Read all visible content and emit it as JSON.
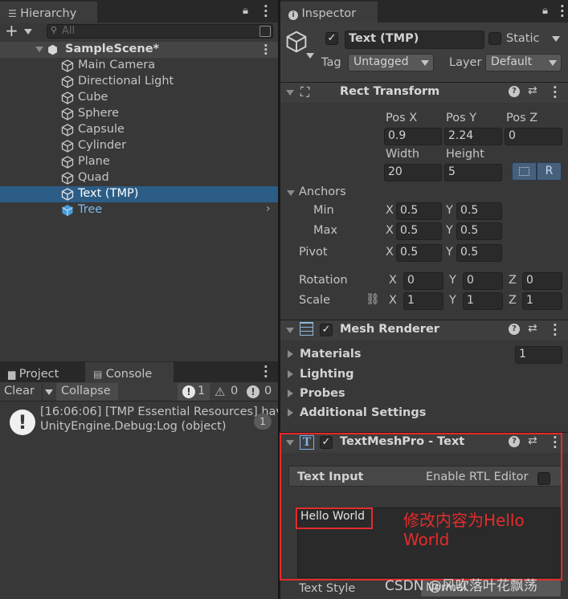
{
  "hierarchy": {
    "tab_label": "Hierarchy",
    "search_placeholder": "All",
    "add_label": "+",
    "scene_name": "SampleScene*",
    "items": [
      {
        "label": "Main Camera"
      },
      {
        "label": "Directional Light"
      },
      {
        "label": "Cube"
      },
      {
        "label": "Sphere"
      },
      {
        "label": "Capsule"
      },
      {
        "label": "Cylinder"
      },
      {
        "label": "Plane"
      },
      {
        "label": "Quad"
      },
      {
        "label": "Text (TMP)"
      },
      {
        "label": "Tree"
      }
    ]
  },
  "bottom_panel": {
    "tabs": [
      {
        "label": "Project"
      },
      {
        "label": "Console"
      }
    ],
    "clear_label": "Clear",
    "collapse_label": "Collapse",
    "counts": {
      "errors": "1",
      "warnings": "0",
      "infos": "0"
    },
    "log": {
      "line1": "[16:06:06] [TMP Essential Resources] hav",
      "line2": "UnityEngine.Debug:Log (object)",
      "count": "1"
    }
  },
  "inspector": {
    "tab_label": "Inspector",
    "object_name": "Text (TMP)",
    "static_label": "Static",
    "tag_label": "Tag",
    "tag_value": "Untagged",
    "layer_label": "Layer",
    "layer_value": "Default",
    "rect_transform": {
      "title": "Rect Transform",
      "pos_x_label": "Pos X",
      "pos_y_label": "Pos Y",
      "pos_z_label": "Pos Z",
      "pos_x": "0.9",
      "pos_y": "2.24",
      "pos_z": "0",
      "width_label": "Width",
      "height_label": "Height",
      "width": "20",
      "height": "5",
      "raw_label": "R",
      "anchors_label": "Anchors",
      "min_label": "Min",
      "max_label": "Max",
      "pivot_label": "Pivot",
      "x": "X",
      "y": "Y",
      "z": "Z",
      "min_x": "0.5",
      "min_y": "0.5",
      "max_x": "0.5",
      "max_y": "0.5",
      "pivot_x": "0.5",
      "pivot_y": "0.5",
      "rotation_label": "Rotation",
      "rot_x": "0",
      "rot_y": "0",
      "rot_z": "0",
      "scale_label": "Scale",
      "scale_x": "1",
      "scale_y": "1",
      "scale_z": "1"
    },
    "mesh_renderer": {
      "title": "Mesh Renderer",
      "materials_label": "Materials",
      "materials_count": "1",
      "lighting_label": "Lighting",
      "probes_label": "Probes",
      "additional_label": "Additional Settings"
    },
    "tmp": {
      "title": "TextMeshPro - Text",
      "text_input_label": "Text Input",
      "rtl_label": "Enable RTL Editor",
      "text_value": "Hello World",
      "text_style_label": "Text Style",
      "text_style_value": "Normal"
    }
  },
  "annotation": {
    "line1": "修改内容为Hello",
    "line2": "World",
    "color": "#e52b2b"
  },
  "watermark": "CSDN @风吹落叶花飘荡"
}
